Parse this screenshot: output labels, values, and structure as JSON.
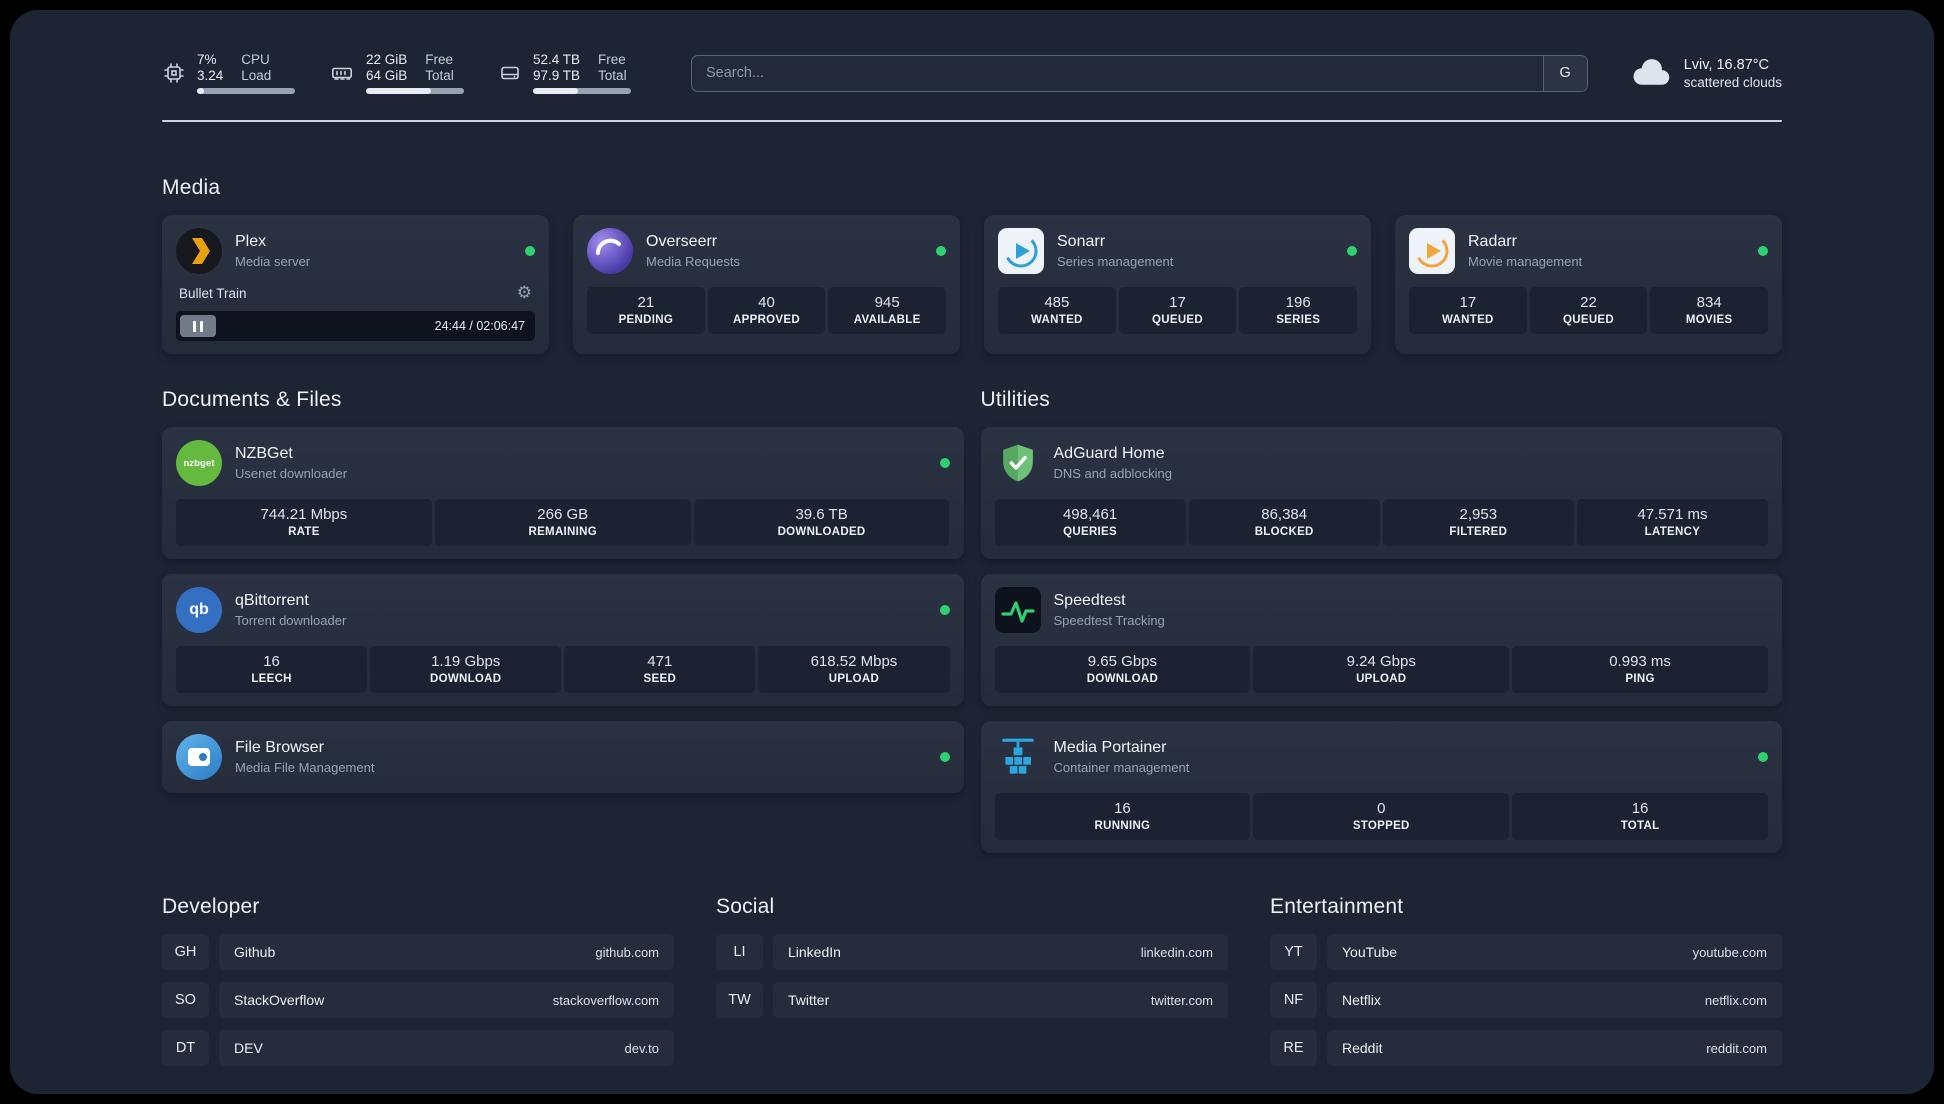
{
  "colors": {
    "background": "#1d2534",
    "card": "#273040",
    "status_online": "#2fd06f",
    "plex_accent": "#e8a00d"
  },
  "icons": {
    "gear": "⚙"
  },
  "topbar": {
    "cpu": {
      "value1": "7%",
      "value2": "3.24",
      "label1": "CPU",
      "label2": "Load",
      "usage_pct": 7
    },
    "ram": {
      "value1": "22 GiB",
      "value2": "64 GiB",
      "label1": "Free",
      "label2": "Total",
      "usage_pct": 66
    },
    "disk": {
      "value1": "52.4 TB",
      "value2": "97.9 TB",
      "label1": "Free",
      "label2": "Total",
      "usage_pct": 46
    },
    "search": {
      "placeholder": "Search...",
      "engine_button": "G"
    },
    "weather": {
      "location": "Lviv, 16.87°C",
      "condition": "scattered clouds"
    }
  },
  "media": {
    "heading": "Media",
    "plex": {
      "name": "Plex",
      "sub": "Media server",
      "now_playing_title": "Bullet Train",
      "time": "24:44 / 02:06:47"
    },
    "overseerr": {
      "name": "Overseerr",
      "sub": "Media Requests",
      "stats": [
        {
          "value": "21",
          "label": "PENDING"
        },
        {
          "value": "40",
          "label": "APPROVED"
        },
        {
          "value": "945",
          "label": "AVAILABLE"
        }
      ]
    },
    "sonarr": {
      "name": "Sonarr",
      "sub": "Series management",
      "stats": [
        {
          "value": "485",
          "label": "WANTED"
        },
        {
          "value": "17",
          "label": "QUEUED"
        },
        {
          "value": "196",
          "label": "SERIES"
        }
      ]
    },
    "radarr": {
      "name": "Radarr",
      "sub": "Movie management",
      "stats": [
        {
          "value": "17",
          "label": "WANTED"
        },
        {
          "value": "22",
          "label": "QUEUED"
        },
        {
          "value": "834",
          "label": "MOVIES"
        }
      ]
    }
  },
  "files": {
    "heading": "Documents & Files",
    "nzbget": {
      "name": "NZBGet",
      "sub": "Usenet downloader",
      "logo_text": "nzbget",
      "stats": [
        {
          "value": "744.21 Mbps",
          "label": "RATE"
        },
        {
          "value": "266 GB",
          "label": "REMAINING"
        },
        {
          "value": "39.6 TB",
          "label": "DOWNLOADED"
        }
      ]
    },
    "qbittorrent": {
      "name": "qBittorrent",
      "sub": "Torrent downloader",
      "logo_text": "qb",
      "stats": [
        {
          "value": "16",
          "label": "LEECH"
        },
        {
          "value": "1.19 Gbps",
          "label": "DOWNLOAD"
        },
        {
          "value": "471",
          "label": "SEED"
        },
        {
          "value": "618.52 Mbps",
          "label": "UPLOAD"
        }
      ]
    },
    "filebrowser": {
      "name": "File Browser",
      "sub": "Media File Management"
    }
  },
  "utilities": {
    "heading": "Utilities",
    "adguard": {
      "name": "AdGuard Home",
      "sub": "DNS and adblocking",
      "stats": [
        {
          "value": "498,461",
          "label": "QUERIES"
        },
        {
          "value": "86,384",
          "label": "BLOCKED"
        },
        {
          "value": "2,953",
          "label": "FILTERED"
        },
        {
          "value": "47.571 ms",
          "label": "LATENCY"
        }
      ]
    },
    "speedtest": {
      "name": "Speedtest",
      "sub": "Speedtest Tracking",
      "stats": [
        {
          "value": "9.65 Gbps",
          "label": "DOWNLOAD"
        },
        {
          "value": "9.24 Gbps",
          "label": "UPLOAD"
        },
        {
          "value": "0.993 ms",
          "label": "PING"
        }
      ]
    },
    "portainer": {
      "name": "Media Portainer",
      "sub": "Container management",
      "stats": [
        {
          "value": "16",
          "label": "RUNNING"
        },
        {
          "value": "0",
          "label": "STOPPED"
        },
        {
          "value": "16",
          "label": "TOTAL"
        }
      ]
    }
  },
  "bookmarks": {
    "developer": {
      "heading": "Developer",
      "items": [
        {
          "abbr": "GH",
          "name": "Github",
          "url": "github.com"
        },
        {
          "abbr": "SO",
          "name": "StackOverflow",
          "url": "stackoverflow.com"
        },
        {
          "abbr": "DT",
          "name": "DEV",
          "url": "dev.to"
        }
      ]
    },
    "social": {
      "heading": "Social",
      "items": [
        {
          "abbr": "LI",
          "name": "LinkedIn",
          "url": "linkedin.com"
        },
        {
          "abbr": "TW",
          "name": "Twitter",
          "url": "twitter.com"
        }
      ]
    },
    "entertainment": {
      "heading": "Entertainment",
      "items": [
        {
          "abbr": "YT",
          "name": "YouTube",
          "url": "youtube.com"
        },
        {
          "abbr": "NF",
          "name": "Netflix",
          "url": "netflix.com"
        },
        {
          "abbr": "RE",
          "name": "Reddit",
          "url": "reddit.com"
        }
      ]
    }
  }
}
